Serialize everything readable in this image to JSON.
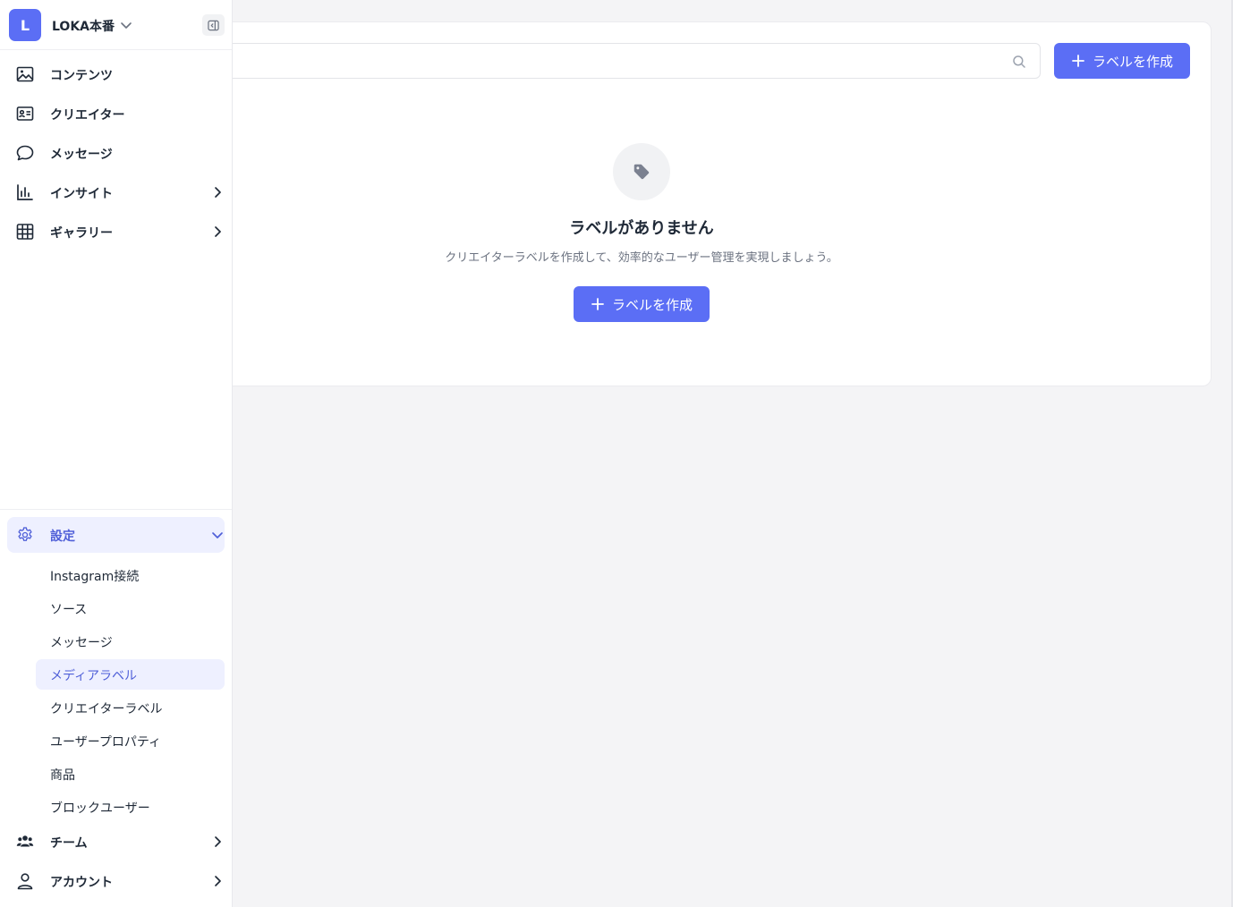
{
  "workspace": {
    "avatar_letter": "L",
    "name": "LOKA本番"
  },
  "search": {
    "value": "",
    "placeholder": ""
  },
  "header": {
    "create_label": "ラベルを作成"
  },
  "empty_state": {
    "icon": "tag-icon",
    "title": "ラベルがありません",
    "description": "クリエイターラベルを作成して、効率的なユーザー管理を実現しましょう。",
    "create_label": "ラベルを作成"
  },
  "sidebar": {
    "items": [
      {
        "label": "コンテンツ",
        "icon": "image-icon"
      },
      {
        "label": "クリエイター",
        "icon": "id-card-icon"
      },
      {
        "label": "メッセージ",
        "icon": "chat-bubble-icon"
      },
      {
        "label": "インサイト",
        "icon": "bar-chart-icon"
      },
      {
        "label": "ギャラリー",
        "icon": "grid-icon"
      }
    ],
    "settings": {
      "label": "設定",
      "icon": "gear-icon",
      "sub_items": [
        "Instagram接続",
        "ソース",
        "メッセージ",
        "メディアラベル",
        "クリエイターラベル",
        "ユーザープロパティ",
        "商品",
        "ブロックユーザー"
      ],
      "active_sub_item": "メディアラベル"
    },
    "team": {
      "label": "チーム",
      "icon": "users-icon"
    },
    "account": {
      "label": "アカウント",
      "icon": "user-icon"
    }
  },
  "colors": {
    "accent": "#5b6ef5",
    "active_bg": "#eef0ff",
    "active_text": "#4f5fd8",
    "page_bg": "#f4f4f6"
  }
}
